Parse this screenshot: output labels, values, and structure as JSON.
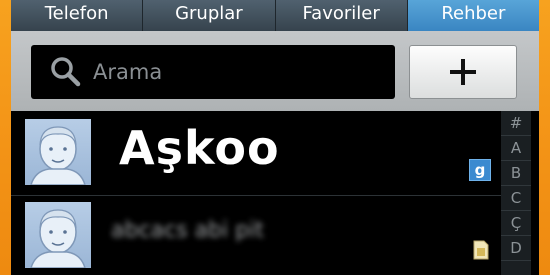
{
  "tabs": [
    {
      "label": "Telefon",
      "active": false
    },
    {
      "label": "Gruplar",
      "active": false
    },
    {
      "label": "Favoriler",
      "active": false
    },
    {
      "label": "Rehber",
      "active": true
    }
  ],
  "search": {
    "placeholder": "Arama",
    "icon": "search-icon"
  },
  "add_button": {
    "icon": "plus-icon"
  },
  "contacts": [
    {
      "name": "Aşkoo",
      "account_badge": "g"
    },
    {
      "name": "abcacs abi pit"
    }
  ],
  "index_letters": [
    "#",
    "A",
    "B",
    "C",
    "Ç",
    "D"
  ],
  "colors": {
    "accent_tab": "#3a86c2",
    "background_frame": "#f39316"
  }
}
